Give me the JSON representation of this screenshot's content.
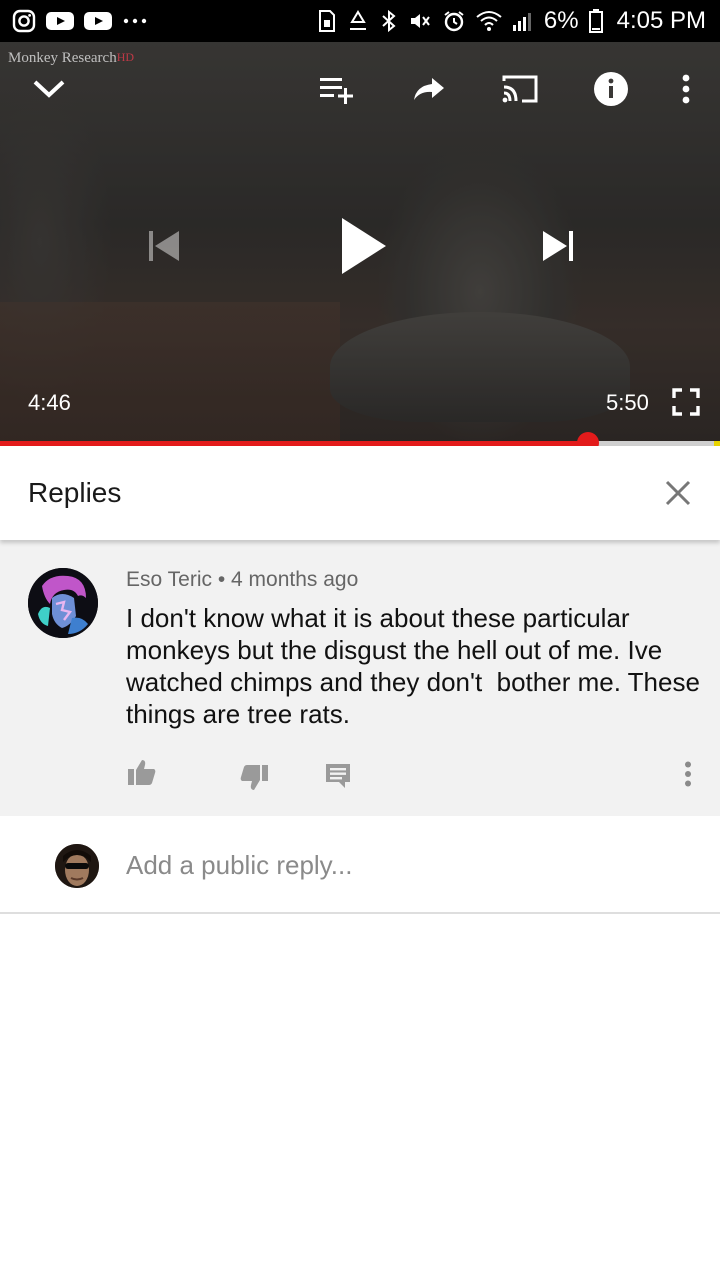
{
  "status_bar": {
    "battery_percent": "6%",
    "time": "4:05 PM",
    "left_icons": [
      "instagram-icon",
      "youtube-icon",
      "youtube-icon",
      "more-notifications-icon"
    ],
    "right_icons": [
      "sim-icon",
      "recycle-icon",
      "bluetooth-icon",
      "mute-icon",
      "alarm-icon",
      "wifi-icon",
      "signal-icon",
      "battery-icon"
    ]
  },
  "player": {
    "watermark": "Monkey Research",
    "watermark_badge": "HD",
    "current_time": "4:46",
    "total_time": "5:50",
    "progress": 0.817,
    "state": "paused",
    "colors": {
      "progress": "#e31b1b",
      "track": "#cfcfcf"
    }
  },
  "replies": {
    "title": "Replies"
  },
  "comment": {
    "author": "Eso Teric",
    "separator": "•",
    "age": "4 months ago",
    "text": "I don't know what it is about these particular monkeys but the disgust the hell out of me. Ive watched chimps and they don't  bother me. These things are tree rats."
  },
  "reply_box": {
    "placeholder": "Add a public reply..."
  }
}
